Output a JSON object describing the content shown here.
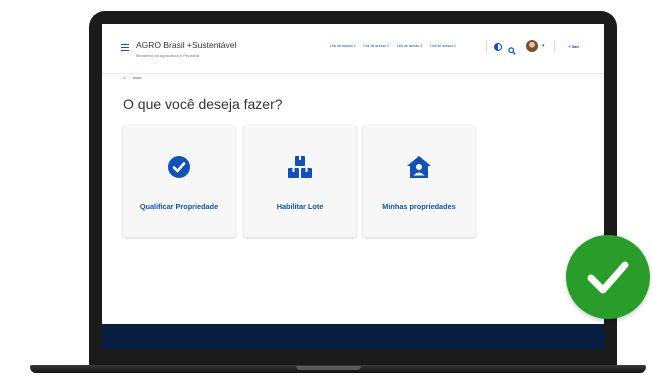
{
  "header": {
    "app_title": "AGRO Brasil +Sustentável",
    "app_subtitle": "Ministério da Agricultura e Pecuária",
    "links": [
      "Link de acesso 1",
      "Link de acesso 2",
      "Link de acesso 3",
      "Link de acesso 4"
    ],
    "logout_label": "Sair"
  },
  "breadcrumb": {
    "home_label": "Início"
  },
  "main": {
    "title": "O que você deseja fazer?",
    "cards": [
      {
        "label": "Qualificar Propriedade",
        "icon": "check-circle-icon"
      },
      {
        "label": "Habilitar Lote",
        "icon": "boxes-icon"
      },
      {
        "label": "Minhas propriedades",
        "icon": "house-user-icon"
      }
    ]
  },
  "colors": {
    "primary_blue": "#1351b4",
    "footer_navy": "#071d41",
    "success_green": "#2a9c2a"
  },
  "badge": {
    "icon": "checkmark-icon"
  }
}
